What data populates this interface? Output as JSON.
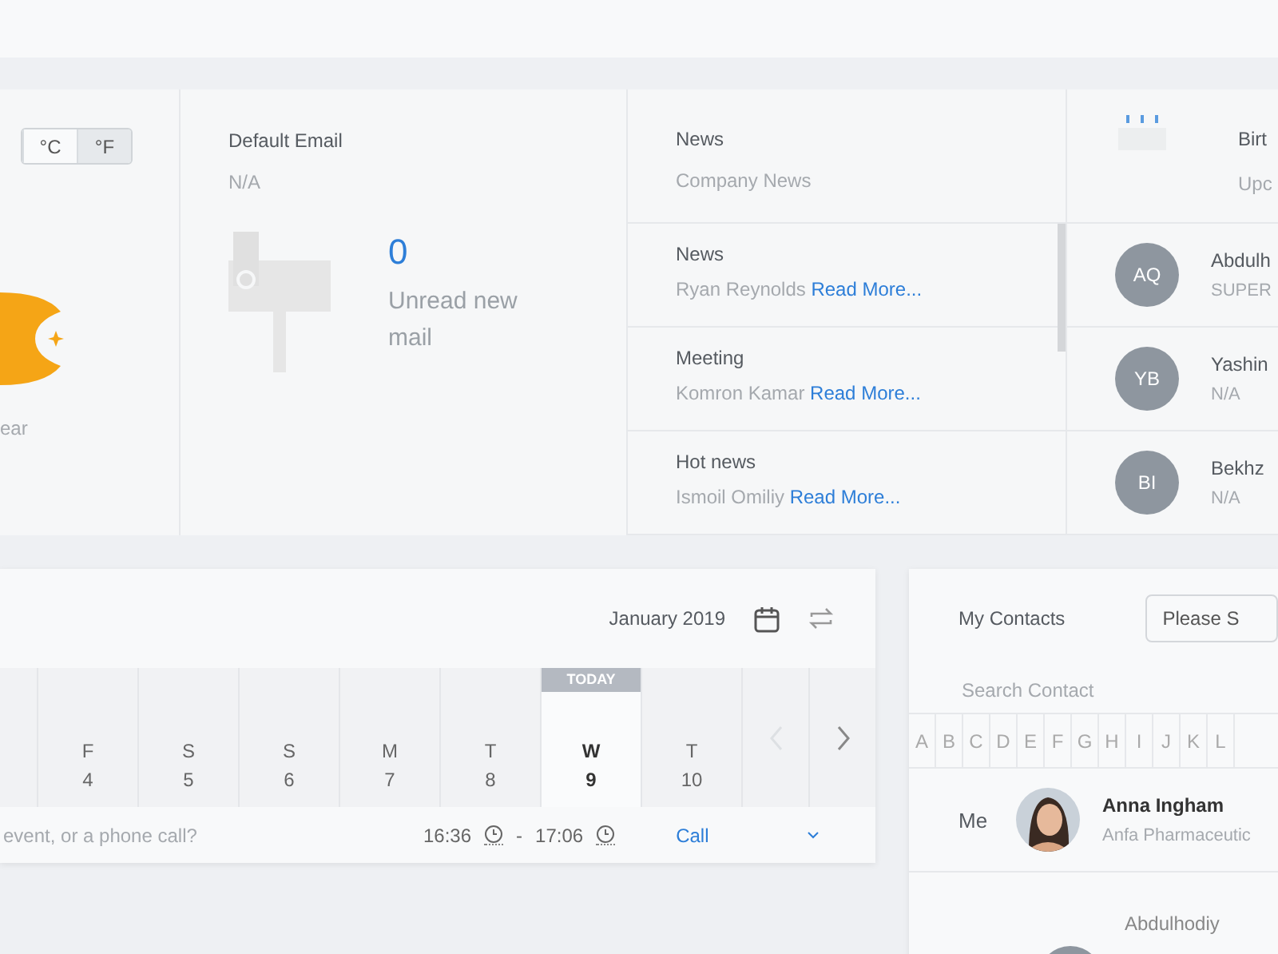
{
  "weather": {
    "units": [
      {
        "label": "°C",
        "selected": false
      },
      {
        "label": "°F",
        "selected": true
      }
    ],
    "condition": "ear"
  },
  "email": {
    "title": "Default Email",
    "address": "N/A",
    "count": "0",
    "caption": "Unread new mail"
  },
  "news": {
    "title": "News",
    "subtitle": "Company News",
    "items": [
      {
        "title": "News",
        "author": "Ryan Reynolds",
        "link": "Read More..."
      },
      {
        "title": "Meeting",
        "author": "Komron Kamar",
        "link": "Read More..."
      },
      {
        "title": "Hot news",
        "author": "Ismoil Omiliy",
        "link": "Read More..."
      }
    ]
  },
  "birthdays": {
    "title": "Birt",
    "subtitle": "Upc",
    "people": [
      {
        "initials": "AQ",
        "name": "Abdulh",
        "role": "SUPER"
      },
      {
        "initials": "YB",
        "name": "Yashin",
        "role": "N/A"
      },
      {
        "initials": "BI",
        "name": "Bekhz",
        "role": "N/A"
      }
    ]
  },
  "calendar": {
    "month": "January 2019",
    "today_label": "TODAY",
    "days": [
      {
        "weekday": "F",
        "date": "4",
        "today": false
      },
      {
        "weekday": "S",
        "date": "5",
        "today": false
      },
      {
        "weekday": "S",
        "date": "6",
        "today": false
      },
      {
        "weekday": "M",
        "date": "7",
        "today": false
      },
      {
        "weekday": "T",
        "date": "8",
        "today": false
      },
      {
        "weekday": "W",
        "date": "9",
        "today": true
      },
      {
        "weekday": "T",
        "date": "10",
        "today": false
      }
    ],
    "event": {
      "placeholder": "event, or a phone call?",
      "start": "16:36",
      "separator": "-",
      "end": "17:06",
      "type": "Call"
    }
  },
  "contacts": {
    "title": "My Contacts",
    "select_placeholder": "Please S",
    "search_placeholder": "Search Contact",
    "letters": [
      "A",
      "B",
      "C",
      "D",
      "E",
      "F",
      "G",
      "H",
      "I",
      "J",
      "K",
      "L"
    ],
    "rows": [
      {
        "label": "Me",
        "name": "Anna Ingham",
        "company": "Anfa Pharmaceutic",
        "kind": "picture"
      },
      {
        "name": "Abdulhodiy",
        "kind": "avatar"
      }
    ]
  }
}
